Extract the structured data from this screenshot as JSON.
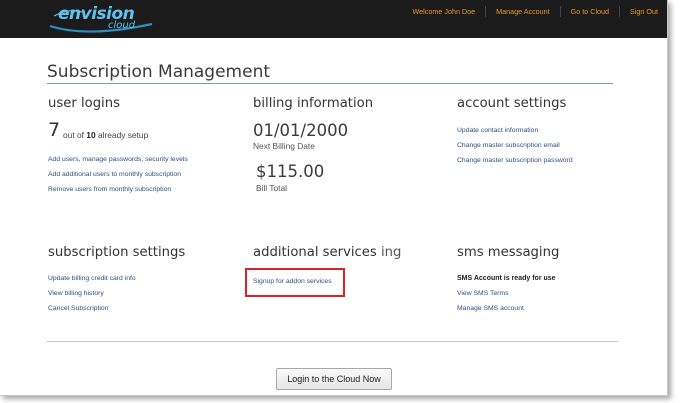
{
  "header": {
    "logo_text": "envision",
    "logo_sub": "cloud",
    "nav": [
      "Welcome John Doe",
      "Manage Account",
      "Go to Cloud",
      "Sign Out"
    ]
  },
  "page_title": "Subscription Management",
  "user_logins": {
    "heading": "user logins",
    "count": "7",
    "out_of_pre": "out of",
    "total": "10",
    "out_of_post": "already setup",
    "links": [
      "Add users, manage passwords, security levels",
      "Add additional users to monthly subscription",
      "Remove users from monthly subscription"
    ]
  },
  "billing": {
    "heading": "billing information",
    "next_date": "01/01/2000",
    "next_label": "Next Billing Date",
    "total": "$115.00",
    "total_label": "Bill Total"
  },
  "account_settings": {
    "heading": "account settings",
    "links": [
      "Update contact information",
      "Change master subscription email",
      "Change master subscription password"
    ]
  },
  "subscription_settings": {
    "heading": "subscription settings",
    "links": [
      "Update billing credit card info",
      "View billing history",
      "Cancel Subscription"
    ]
  },
  "additional_services": {
    "heading": "additional services",
    "heading_trail": "ing",
    "links": [
      "Signup for addon services"
    ]
  },
  "sms": {
    "heading": "sms messaging",
    "status": "SMS Account is ready for use",
    "links": [
      "View SMS Terms",
      "Manage SMS account"
    ]
  },
  "login_button": "Login to the Cloud Now",
  "colors": {
    "header_bg": "#1b1b1b",
    "nav_text": "#e89a2c",
    "logo": "#5fc3ee",
    "link": "#2c4f7c",
    "highlight": "#d9222a"
  }
}
